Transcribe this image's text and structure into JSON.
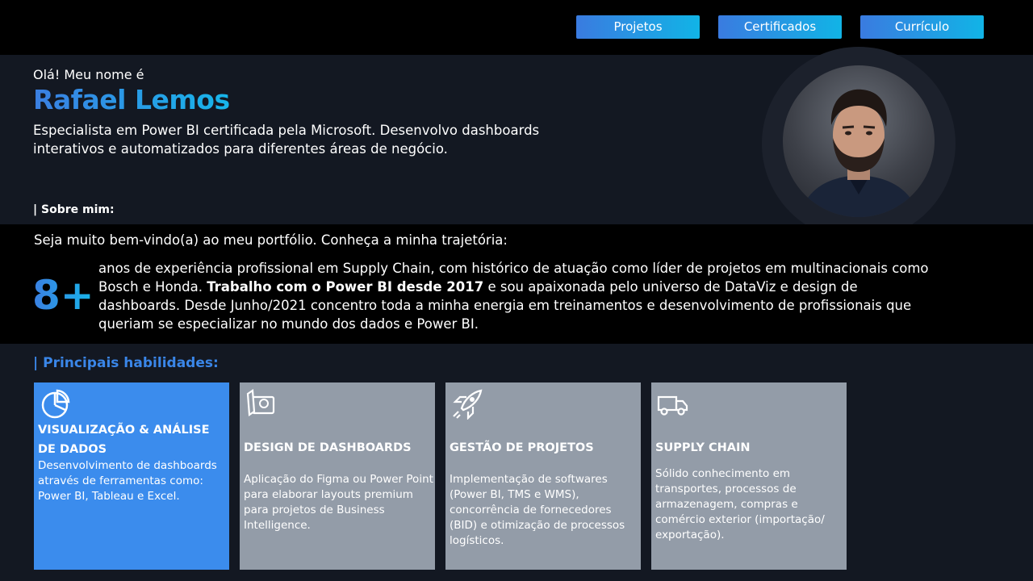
{
  "nav": {
    "items": [
      {
        "label": "Projetos"
      },
      {
        "label": "Certificados"
      },
      {
        "label": "Currículo"
      }
    ]
  },
  "hero": {
    "greeting": "Olá! Meu nome é",
    "name": "Rafael Lemos",
    "tagline": "Especialista em Power BI certificada pela Microsoft. Desenvolvo dashboards interativos e automatizados para diferentes áreas de negócio.",
    "about_label": "| Sobre mim:"
  },
  "about": {
    "welcome": "Seja muito bem-vindo(a) ao meu portfólio. Conheça a minha trajetória:",
    "years": "8+",
    "text_before": "anos de experiência profissional em Supply Chain, com histórico de atuação como líder de projetos em multinacionais como Bosch e Honda. ",
    "text_bold": "Trabalho com o Power BI desde 2017",
    "text_after": " e sou apaixonada pelo universo de DataViz e design de dashboards. Desde Junho/2021 concentro toda a minha energia em treinamentos e desenvolvimento de profissionais que queriam se especializar no mundo dos dados e Power BI."
  },
  "skills": {
    "title": "| Principais habilidades:",
    "cards": [
      {
        "icon": "pie-chart-icon",
        "title": "VISUALIZAÇÃO & ANÁLISE DE DADOS",
        "description": "Desenvolvimento de dashboards através de ferramentas como: Power BI, Tableau e Excel."
      },
      {
        "icon": "design-tools-icon",
        "title": "DESIGN DE DASHBOARDS",
        "description": "Aplicação do Figma ou Power Point para elaborar layouts premium para projetos de Business Intelligence."
      },
      {
        "icon": "rocket-icon",
        "title": "GESTÃO DE PROJETOS",
        "description": "Implementação de softwares (Power BI, TMS e WMS), concorrência de fornecedores (BID) e otimização de processos logísticos."
      },
      {
        "icon": "truck-icon",
        "title": "SUPPLY CHAIN",
        "description": "Sólido conhecimento em transportes, processos de armazenagem, compras e comércio exterior (importação/ exportação)."
      }
    ]
  },
  "colors": {
    "accent_start": "#3b7fe2",
    "accent_end": "#17b6ea",
    "active_card": "#3b8ced",
    "card": "#939ca8",
    "background": "#131822"
  }
}
